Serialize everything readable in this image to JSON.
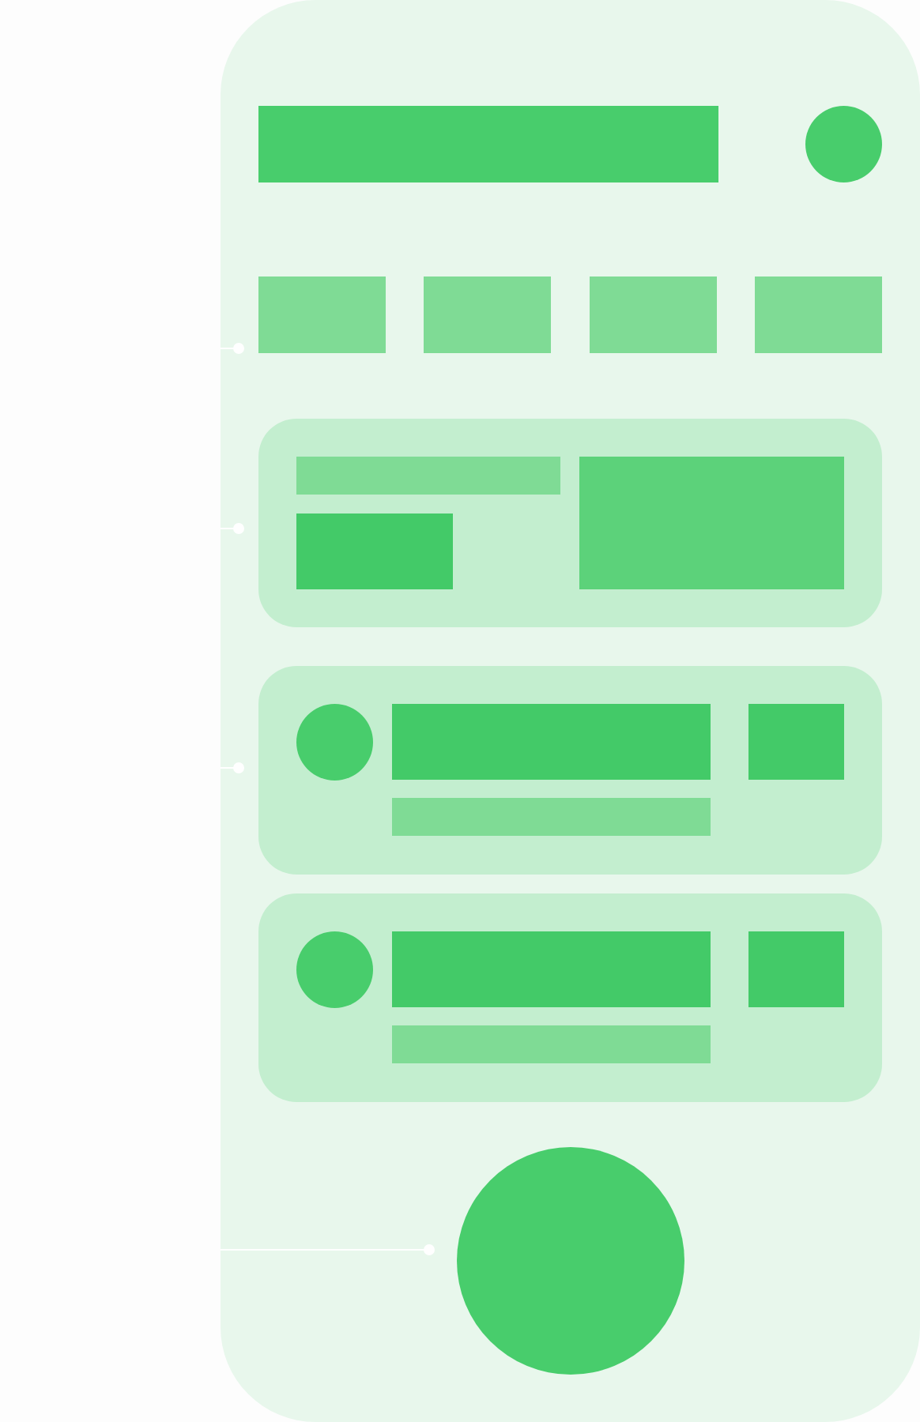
{
  "sections": [
    {
      "kind": "header",
      "marker": false
    },
    {
      "kind": "tab_row",
      "marker": true,
      "tabs": [
        {
          "kind": "tab"
        },
        {
          "kind": "tab"
        },
        {
          "kind": "tab"
        },
        {
          "kind": "tab"
        }
      ]
    },
    {
      "kind": "media_card",
      "marker": true
    },
    {
      "kind": "list_card",
      "marker": true
    },
    {
      "kind": "list_card",
      "marker": false
    },
    {
      "kind": "action_button",
      "marker": true
    }
  ]
}
